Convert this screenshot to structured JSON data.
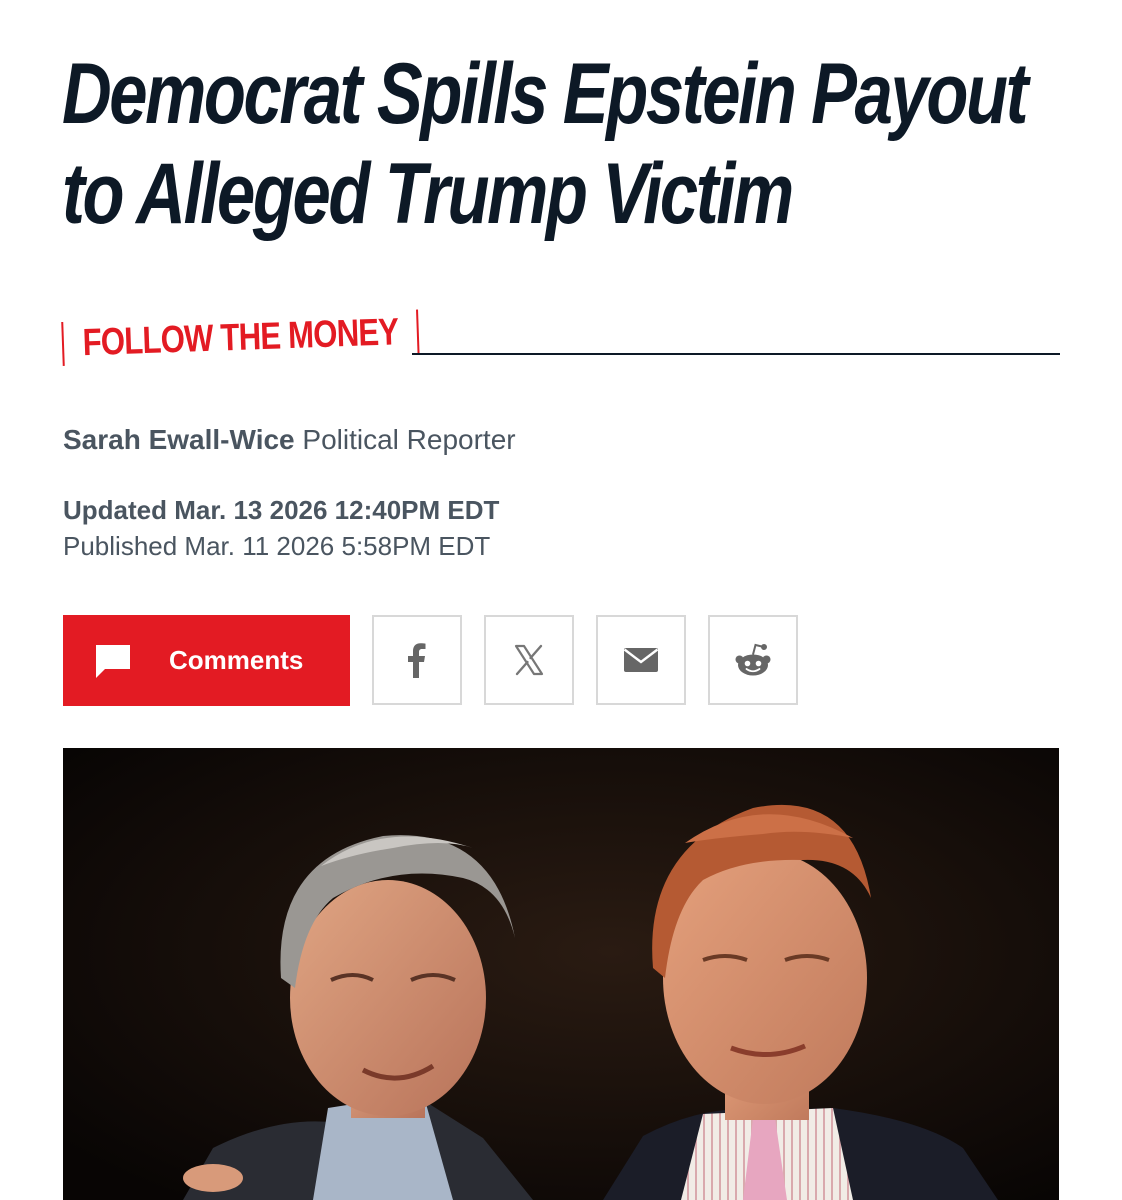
{
  "article": {
    "headline_lines": [
      "Democrat Spills Epstein Payout",
      "to Alleged Trump Victim"
    ],
    "kicker": "FOLLOW THE MONEY",
    "author": "Sarah Ewall-Wice",
    "author_role": "Political Reporter",
    "updated": "Updated Mar. 13 2026 12:40PM EDT",
    "published": "Published Mar. 11 2026 5:58PM EDT"
  },
  "share": {
    "comments_label": "Comments",
    "buttons": [
      {
        "icon": "facebook-icon"
      },
      {
        "icon": "x-icon"
      },
      {
        "icon": "email-icon"
      },
      {
        "icon": "reddit-icon"
      }
    ]
  },
  "colors": {
    "accent": "#e31b23",
    "headline": "#0d1926",
    "meta_text": "#4a5560",
    "share_border": "#d8d8d8",
    "icon_gray": "#666666"
  }
}
